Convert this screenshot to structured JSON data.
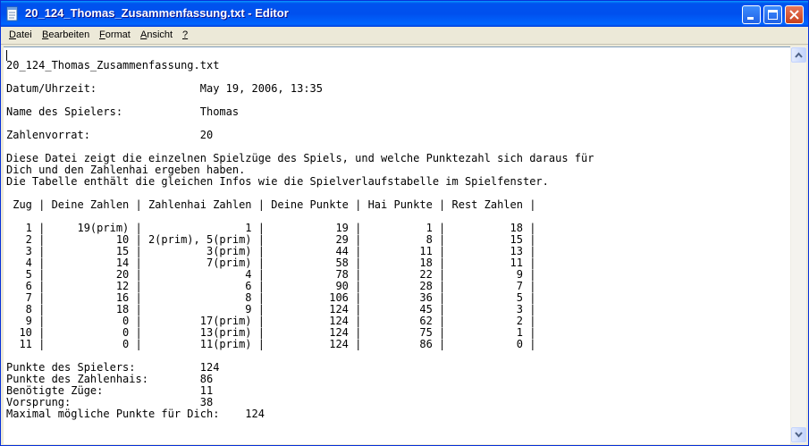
{
  "window": {
    "title": "20_124_Thomas_Zusammenfassung.txt - Editor"
  },
  "menu": {
    "file_u": "D",
    "file_rest": "atei",
    "edit_u": "B",
    "edit_rest": "earbeiten",
    "format_u": "F",
    "format_rest": "ormat",
    "view_u": "A",
    "view_rest": "nsicht",
    "help": "?"
  },
  "document": {
    "text": "\n20_124_Thomas_Zusammenfassung.txt\n\nDatum/Uhrzeit:                May 19, 2006, 13:35\n\nName des Spielers:            Thomas\n\nZahlenvorrat:                 20\n\nDiese Datei zeigt die einzelnen Spielzüge des Spiels, und welche Punktezahl sich daraus für\nDich und den Zahlenhai ergeben haben.\nDie Tabelle enthält die gleichen Infos wie die Spielverlaufstabelle im Spielfenster.\n\n Zug | Deine Zahlen | Zahlenhai Zahlen | Deine Punkte | Hai Punkte | Rest Zahlen |\n\n   1 |     19(prim) |                1 |           19 |          1 |          18 |\n   2 |           10 | 2(prim), 5(prim) |           29 |          8 |          15 |\n   3 |           15 |          3(prim) |           44 |         11 |          13 |\n   4 |           14 |          7(prim) |           58 |         18 |          11 |\n   5 |           20 |                4 |           78 |         22 |           9 |\n   6 |           12 |                6 |           90 |         28 |           7 |\n   7 |           16 |                8 |          106 |         36 |           5 |\n   8 |           18 |                9 |          124 |         45 |           3 |\n   9 |            0 |         17(prim) |          124 |         62 |           2 |\n  10 |            0 |         13(prim) |          124 |         75 |           1 |\n  11 |            0 |         11(prim) |          124 |         86 |           0 |\n\nPunkte des Spielers:          124\nPunkte des Zahlenhais:        86\nBenötigte Züge:               11\nVorsprung:                    38\nMaximal mögliche Punkte für Dich:    124"
  }
}
